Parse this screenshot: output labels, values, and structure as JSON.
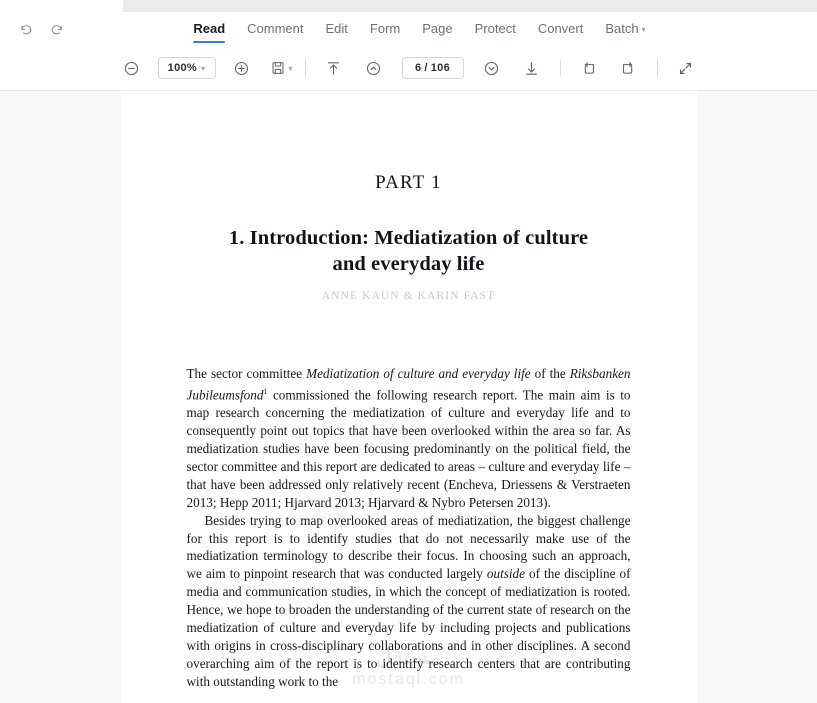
{
  "window": {
    "tabstrip_active_tab": ""
  },
  "header": {
    "history": {
      "undo_label": "Undo",
      "undo_icon": "undo-arrow-icon",
      "redo_label": "Redo",
      "redo_icon": "redo-arrow-icon"
    },
    "tabs": [
      {
        "id": "read",
        "label": "Read",
        "active": true,
        "has_caret": false
      },
      {
        "id": "comment",
        "label": "Comment",
        "active": false,
        "has_caret": false
      },
      {
        "id": "edit",
        "label": "Edit",
        "active": false,
        "has_caret": false
      },
      {
        "id": "form",
        "label": "Form",
        "active": false,
        "has_caret": false
      },
      {
        "id": "page",
        "label": "Page",
        "active": false,
        "has_caret": false
      },
      {
        "id": "protect",
        "label": "Protect",
        "active": false,
        "has_caret": false
      },
      {
        "id": "convert",
        "label": "Convert",
        "active": false,
        "has_caret": false
      },
      {
        "id": "batch",
        "label": "Batch",
        "active": false,
        "has_caret": true
      }
    ],
    "active_tab_accent": "#2f7ae5"
  },
  "toolbar": {
    "zoom_out_icon": "zoom-out-circle-icon",
    "zoom_value": "100%",
    "zoom_caret": "∨",
    "zoom_in_icon": "zoom-in-circle-icon",
    "page_layout_icon": "page-layout-icon",
    "page_layout_caret": "∨",
    "first_page_icon": "first-page-icon",
    "prev_page_icon": "previous-page-icon",
    "current_page": "6",
    "page_separator": "/",
    "total_pages": "106",
    "next_page_icon": "next-page-icon",
    "last_page_icon": "last-page-icon",
    "rotate_left_icon": "rotate-left-icon",
    "rotate_right_icon": "rotate-right-icon",
    "fullscreen_icon": "fullscreen-expand-icon"
  },
  "document": {
    "part_title": "PART 1",
    "chapter_title_line1": "1. Introduction: Mediatization of culture",
    "chapter_title_line2": "and everyday life",
    "authors": "ANNE KAUN & KARIN FAST",
    "paragraph1": {
      "seg1": "The sector committee ",
      "italic1": "Mediatization of culture and everyday life",
      "seg2": " of the ",
      "italic2": "Riksbanken Jubileumsfond",
      "footnote": "1",
      "seg3": " commissioned the following research report. The main aim is to map research concerning the mediatization of culture and everyday life and to consequently point out topics that have been overlooked within the area so far. As mediatization studies have been focusing predominantly on the political field, the sector committee and this report are dedicated to areas – culture and everyday life – that have been addressed only relatively recent (Encheva, Driessens & Verstraeten 2013; Hepp 2011; Hjarvard 2013; Hjarvard & Nybro Petersen 2013)."
    },
    "paragraph2": {
      "seg1": "Besides trying to map overlooked areas of mediatization, the biggest challenge for this report is to identify studies that do not necessarily make use of the mediatization terminology to describe their focus. In choosing such an approach, we aim to pinpoint research that was conducted largely ",
      "italic1": "outside",
      "seg2": " of the discipline of media and communication studies, in which the concept of mediatization is rooted. Hence, we hope to broaden the understanding of the current state of research on the mediatization of culture and everyday life by including projects and publications with origins in cross-disciplinary collaborations and in other disciplines. A second overarching aim of the report is to identify research centers that are contributing with outstanding work to the"
    },
    "watermark": {
      "arabic": "مستقل",
      "domain": "mostaql.com"
    }
  }
}
